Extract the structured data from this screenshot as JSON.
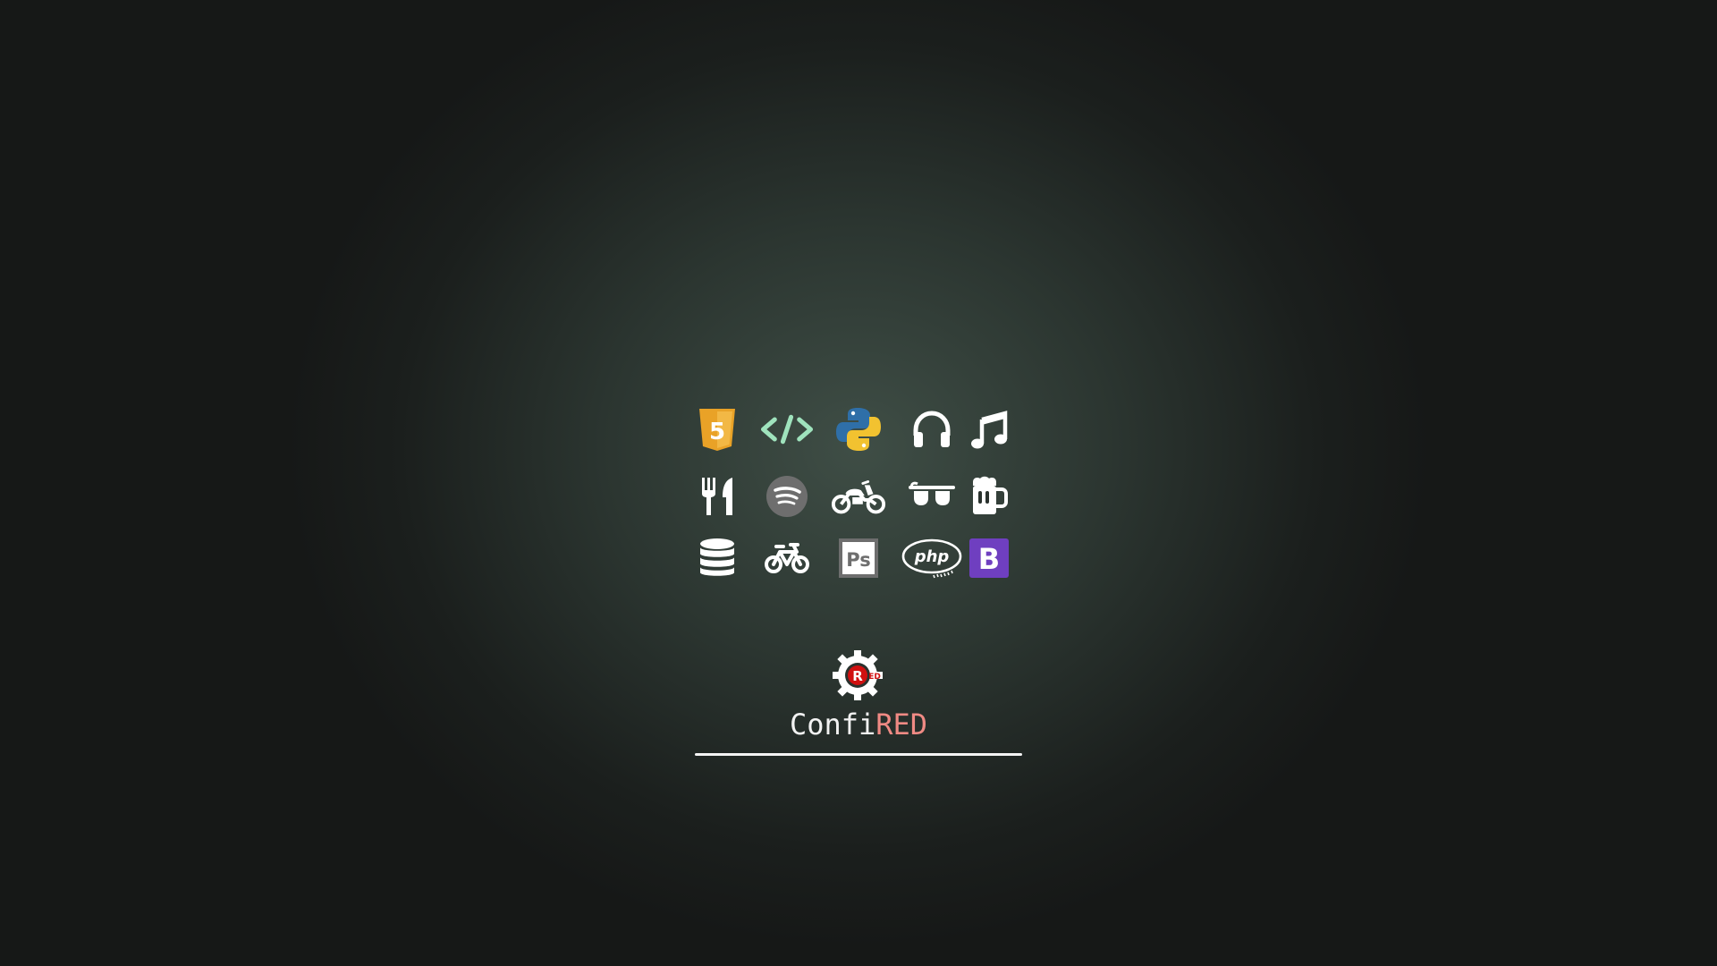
{
  "icons": [
    {
      "name": "html5-icon"
    },
    {
      "name": "code-icon"
    },
    {
      "name": "python-icon"
    },
    {
      "name": "headphones-icon"
    },
    {
      "name": "music-note-icon"
    },
    {
      "name": "utensils-icon"
    },
    {
      "name": "spotify-icon"
    },
    {
      "name": "motorcycle-icon"
    },
    {
      "name": "sunglasses-icon"
    },
    {
      "name": "beer-mug-icon"
    },
    {
      "name": "database-icon"
    },
    {
      "name": "bicycle-icon"
    },
    {
      "name": "photoshop-icon"
    },
    {
      "name": "php-icon"
    },
    {
      "name": "bootstrap-icon"
    }
  ],
  "photoshop_label": "Ps",
  "php_label": "php",
  "bootstrap_label": "B",
  "html5_label": "5",
  "logo": {
    "name": "confired-gear-logo",
    "letter": "R",
    "tag": "ED"
  },
  "brand": {
    "part1": "Confi",
    "part2": "RED"
  },
  "colors": {
    "html5": "#e9a227",
    "code": "#9fe3bd",
    "python_blue": "#2f6fa8",
    "python_yellow": "#f2c230",
    "spotify_bg": "#6e6e6e",
    "bootstrap": "#6f3fc0",
    "brand_red": "#f08a84",
    "logo_red": "#d01010"
  }
}
